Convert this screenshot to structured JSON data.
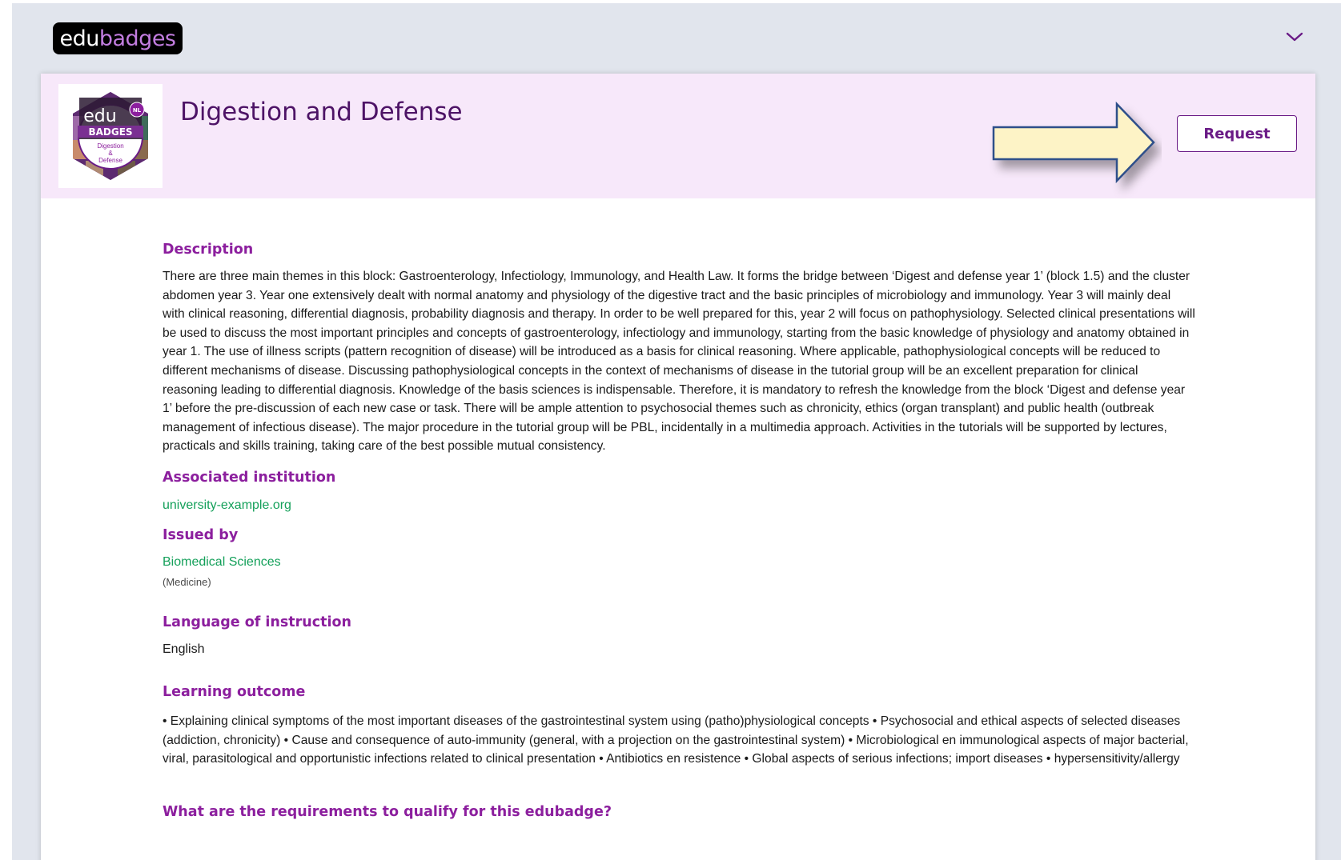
{
  "app": {
    "logo_part1": "edu",
    "logo_part2": "badges"
  },
  "badge": {
    "image_text_top": "edu",
    "image_text_mid": "BADGES",
    "image_text_line1": "Digestion",
    "image_text_line2": "&",
    "image_text_line3": "Defense",
    "image_corner": "NL",
    "title": "Digestion and Defense",
    "request_label": "Request"
  },
  "sections": {
    "description": {
      "title": "Description",
      "text": "There are three main themes in this block: Gastroenterology, Infectiology, Immunology, and Health Law. It forms the bridge between ‘Digest and defense year 1’ (block 1.5) and the cluster abdomen year 3. Year one extensively dealt with normal anatomy and physiology of the digestive tract and the basic principles of microbiology and immunology. Year 3 will mainly deal with clinical reasoning, differential diagnosis, probability diagnosis and therapy. In order to be well prepared for this, year 2 will focus on pathophysiology. Selected clinical presentations will be used to discuss the most important principles and concepts of gastroenterology, infectiology and immunology, starting from the basic knowledge of physiology and anatomy obtained in year 1. The use of illness scripts (pattern recognition of disease) will be introduced as a basis for clinical reasoning. Where applicable, pathophysiological concepts will be reduced to different mechanisms of disease. Discussing pathophysiological concepts in the context of mechanisms of disease in the tutorial group will be an excellent preparation for clinical reasoning leading to differential diagnosis. Knowledge of the basis sciences is indispensable. Therefore, it is mandatory to refresh the knowledge from the block ‘Digest and defense year 1’ before the pre-discussion of each new case or task. There will be ample attention to psychosocial themes such as chronicity, ethics (organ transplant) and public health (outbreak management of infectious disease). The major procedure in the tutorial group will be PBL, incidentally in a multimedia approach. Activities in the tutorials will be supported by lectures, practicals and skills training, taking care of the best possible mutual consistency."
    },
    "institution": {
      "title": "Associated institution",
      "value": "university-example.org"
    },
    "issued_by": {
      "title": "Issued by",
      "value": "Biomedical Sciences",
      "sub": "(Medicine)"
    },
    "language": {
      "title": "Language of instruction",
      "value": "English"
    },
    "learning_outcome": {
      "title": "Learning outcome",
      "text": "• Explaining clinical symptoms of the most important diseases of the gastrointestinal system using (patho)physiological concepts • Psychosocial and ethical aspects of selected diseases (addiction, chronicity) • Cause and consequence of auto-immunity (general, with a projection on the gastrointestinal system) • Microbiological en immunological aspects of major bacterial, viral, parasitological and opportunistic infections related to clinical presentation • Antibiotics en resistence • Global aspects of serious infections; import diseases • hypersensitivity/allergy"
    },
    "requirements": {
      "title": "What are the requirements to qualify for this edubadge?"
    }
  },
  "colors": {
    "brand_purple": "#6a1b86",
    "heading_purple": "#8c1f9e",
    "link_green": "#14a05a",
    "header_bg": "#f7e8fa",
    "page_bg": "#e1e5ed",
    "arrow_fill": "#fdf3c6",
    "arrow_stroke": "#2f4f8a"
  }
}
